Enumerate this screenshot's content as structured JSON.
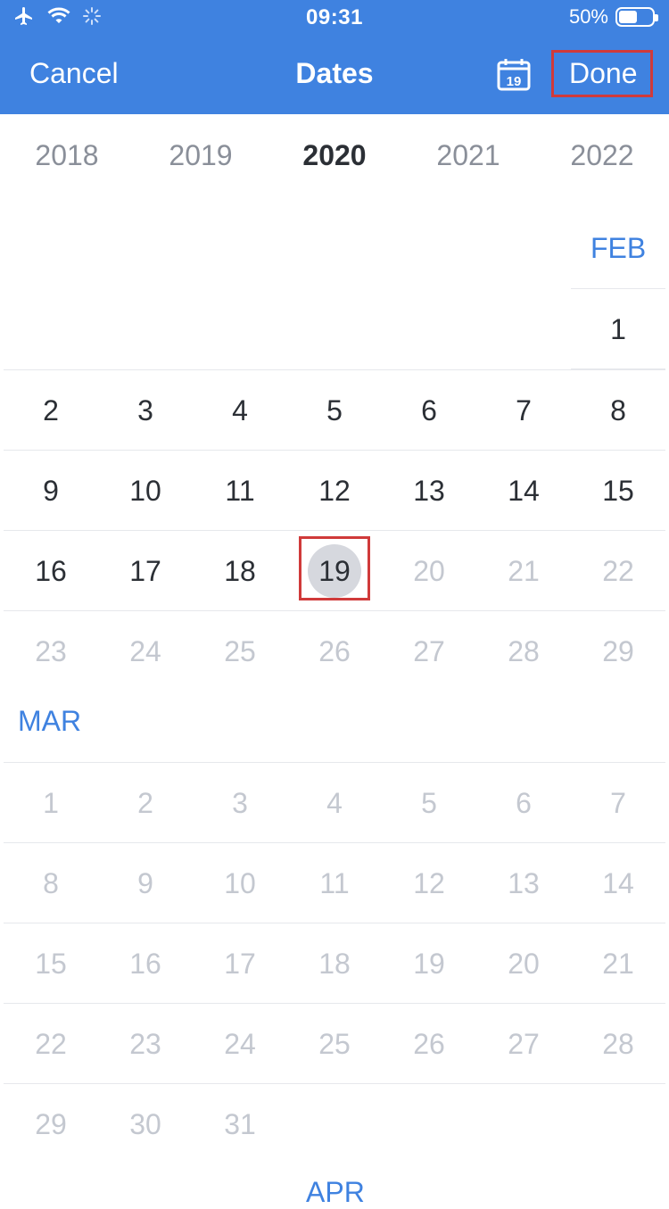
{
  "status": {
    "time": "09:31",
    "battery": "50%"
  },
  "nav": {
    "cancel": "Cancel",
    "title": "Dates",
    "calendar_icon_day": "19",
    "done": "Done"
  },
  "years": [
    "2018",
    "2019",
    "2020",
    "2021",
    "2022"
  ],
  "active_year_index": 2,
  "feb": {
    "label": "FEB",
    "first_row": [
      "1"
    ],
    "rows": [
      [
        "2",
        "3",
        "4",
        "5",
        "6",
        "7",
        "8"
      ],
      [
        "9",
        "10",
        "11",
        "12",
        "13",
        "14",
        "15"
      ],
      [
        "16",
        "17",
        "18",
        "19",
        "20",
        "21",
        "22"
      ],
      [
        "23",
        "24",
        "25",
        "26",
        "27",
        "28",
        "29"
      ]
    ],
    "selected": "19"
  },
  "mar": {
    "label": "MAR",
    "rows": [
      [
        "1",
        "2",
        "3",
        "4",
        "5",
        "6",
        "7"
      ],
      [
        "8",
        "9",
        "10",
        "11",
        "12",
        "13",
        "14"
      ],
      [
        "15",
        "16",
        "17",
        "18",
        "19",
        "20",
        "21"
      ],
      [
        "22",
        "23",
        "24",
        "25",
        "26",
        "27",
        "28"
      ],
      [
        "29",
        "30",
        "31"
      ]
    ]
  },
  "apr": {
    "label": "APR"
  },
  "colors": {
    "accent": "#3f82e0",
    "dark_text": "#2b2f35",
    "light_text": "#c4c8d0",
    "highlight": "#d03a3a"
  }
}
